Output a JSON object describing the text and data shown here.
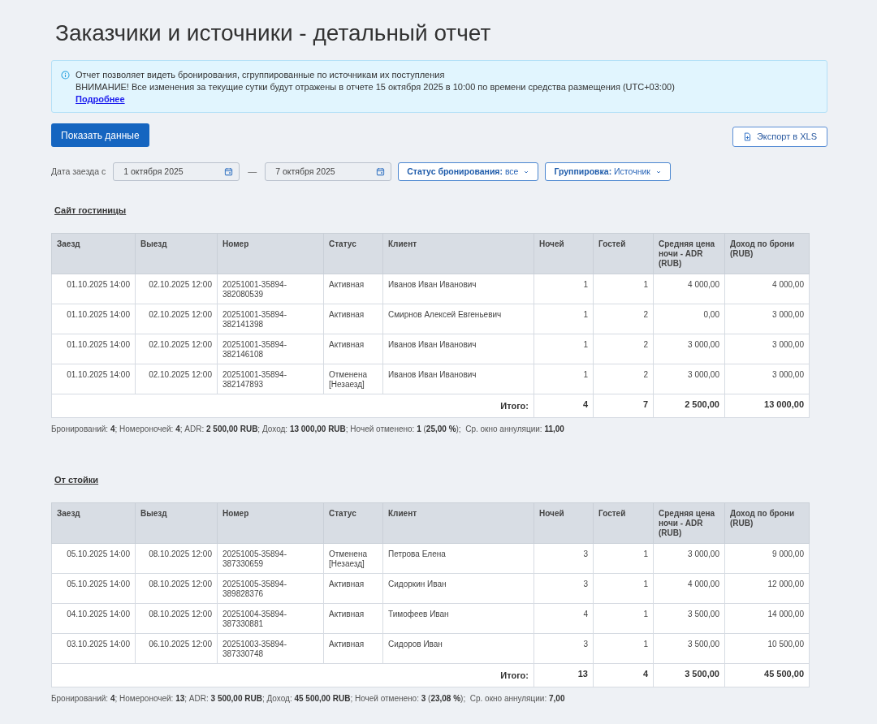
{
  "title": "Заказчики и источники - детальный отчет",
  "info": {
    "lines": [
      "Отчет позволяет видеть бронирования, сгруппированные по источникам их поступления",
      "ВНИМАНИЕ! Все изменения за текущие сутки будут отражены в отчете 15 октября 2025 в 10:00 по времени средства размещения (UTC+03:00)"
    ],
    "link": "Подробнее"
  },
  "toolbar": {
    "show_button": "Показать данные",
    "export_button": "Экспорт в XLS"
  },
  "filters": {
    "date_label": "Дата заезда с",
    "date_from": "1 октября 2025",
    "separator": "—",
    "date_to": "7 октября 2025",
    "dropdowns": [
      {
        "label": "Статус бронирования:",
        "value": "все"
      },
      {
        "label": "Группировка:",
        "value": "Источник"
      }
    ]
  },
  "sections": [
    {
      "heading": "Сайт гостиницы",
      "table": {
        "columns": [
          "Заезд",
          "Выезд",
          "Номер",
          "Статус",
          "Клиент",
          "Ночей",
          "Гостей",
          "Средняя цена ночи - ADR (RUB)",
          "Доход по брони (RUB)"
        ],
        "rows": [
          [
            "01.10.2025 14:00",
            "02.10.2025 12:00",
            "20251001-35894-382080539",
            "Активная",
            "Иванов Иван Иванович",
            "1",
            "1",
            "4 000,00",
            "4 000,00"
          ],
          [
            "01.10.2025 14:00",
            "02.10.2025 12:00",
            "20251001-35894-382141398",
            "Активная",
            "Смирнов Алексей Евгеньевич",
            "1",
            "2",
            "0,00",
            "3 000,00"
          ],
          [
            "01.10.2025 14:00",
            "02.10.2025 12:00",
            "20251001-35894-382146108",
            "Активная",
            "Иванов Иван Иванович",
            "1",
            "2",
            "3 000,00",
            "3 000,00"
          ],
          [
            "01.10.2025 14:00",
            "02.10.2025 12:00",
            "20251001-35894-382147893",
            "Отменена [Незаезд]",
            "Иванов Иван Иванович",
            "1",
            "2",
            "3 000,00",
            "3 000,00"
          ]
        ],
        "total": {
          "label": "Итого:",
          "values": [
            "4",
            "7",
            "2 500,00",
            "13 000,00"
          ]
        }
      },
      "summary": "Бронирований: **4**; Номероночей: **4**; ADR: **2 500,00 RUB**; Доход: **13 000,00 RUB**; Ночей отменено: **1** (**25,00 %**);  Ср. окно аннуляции: **11,00**"
    },
    {
      "heading": "От стойки",
      "table": {
        "columns": [
          "Заезд",
          "Выезд",
          "Номер",
          "Статус",
          "Клиент",
          "Ночей",
          "Гостей",
          "Средняя цена ночи - ADR (RUB)",
          "Доход по брони (RUB)"
        ],
        "rows": [
          [
            "05.10.2025 14:00",
            "08.10.2025 12:00",
            "20251005-35894-387330659",
            "Отменена [Незаезд]",
            "Петрова Елена",
            "3",
            "1",
            "3 000,00",
            "9 000,00"
          ],
          [
            "05.10.2025 14:00",
            "08.10.2025 12:00",
            "20251005-35894-389828376",
            "Активная",
            "Сидоркин Иван",
            "3",
            "1",
            "4 000,00",
            "12 000,00"
          ],
          [
            "04.10.2025 14:00",
            "08.10.2025 12:00",
            "20251004-35894-387330881",
            "Активная",
            "Тимофеев Иван",
            "4",
            "1",
            "3 500,00",
            "14 000,00"
          ],
          [
            "03.10.2025 14:00",
            "06.10.2025 12:00",
            "20251003-35894-387330748",
            "Активная",
            "Сидоров Иван",
            "3",
            "1",
            "3 500,00",
            "10 500,00"
          ]
        ],
        "total": {
          "label": "Итого:",
          "values": [
            "13",
            "4",
            "3 500,00",
            "45 500,00"
          ]
        }
      },
      "summary": "Бронирований: **4**; Номероночей: **13**; ADR: **3 500,00 RUB**; Доход: **45 500,00 RUB**; Ночей отменено: **3** (**23,08 %**);  Ср. окно аннуляции: **7,00**"
    }
  ]
}
